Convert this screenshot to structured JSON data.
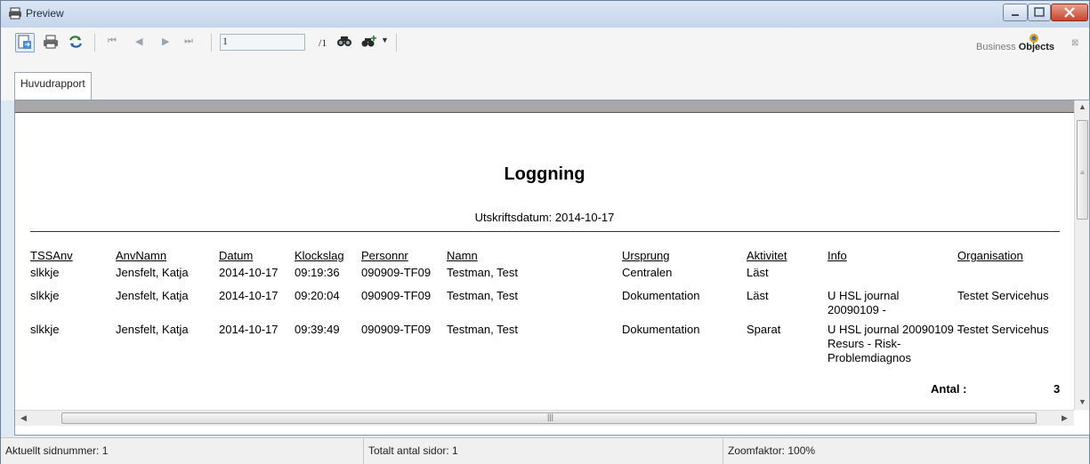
{
  "window": {
    "title": "Preview"
  },
  "toolbar": {
    "page_value": "1",
    "page_total": "/1",
    "brand_prefix": "Business",
    "brand_name": "Objects",
    "tab_label": "Huvudrapport",
    "icons": [
      "export-icon",
      "print-icon",
      "refresh-icon",
      "first-page-icon",
      "prev-page-icon",
      "next-page-icon",
      "last-page-icon",
      "search-icon",
      "zoom-icon"
    ]
  },
  "report": {
    "title": "Loggning",
    "print_date": "Utskriftsdatum: 2014-10-17",
    "columns": [
      "TSSAnv",
      "AnvNamn",
      "Datum",
      "Klockslag",
      "Personnr",
      "Namn",
      "Ursprung",
      "Aktivitet",
      "Info",
      "Organisation"
    ],
    "rows": [
      [
        "slkkje",
        "Jensfelt, Katja",
        "2014-10-17",
        "09:19:36",
        "090909-TF09",
        "Testman, Test",
        "Centralen",
        "Läst",
        "",
        ""
      ],
      [
        "slkkje",
        "Jensfelt, Katja",
        "2014-10-17",
        "09:20:04",
        "090909-TF09",
        "Testman, Test",
        "Dokumentation",
        "Läst",
        "U HSL journal 20090109 -",
        "Testet Servicehus"
      ],
      [
        "slkkje",
        "Jensfelt, Katja",
        "2014-10-17",
        "09:39:49",
        "090909-TF09",
        "Testman, Test",
        "Dokumentation",
        "Sparat",
        "U HSL journal 20090109 - Resurs - Risk- Problemdiagnos",
        "Testet Servicehus"
      ]
    ],
    "antal_label": "Antal :",
    "antal_value": "3"
  },
  "statusbar": {
    "page_number": "Aktuellt sidnummer: 1",
    "total_pages": "Totalt antal sidor: 1",
    "zoom": "Zoomfaktor: 100%"
  }
}
